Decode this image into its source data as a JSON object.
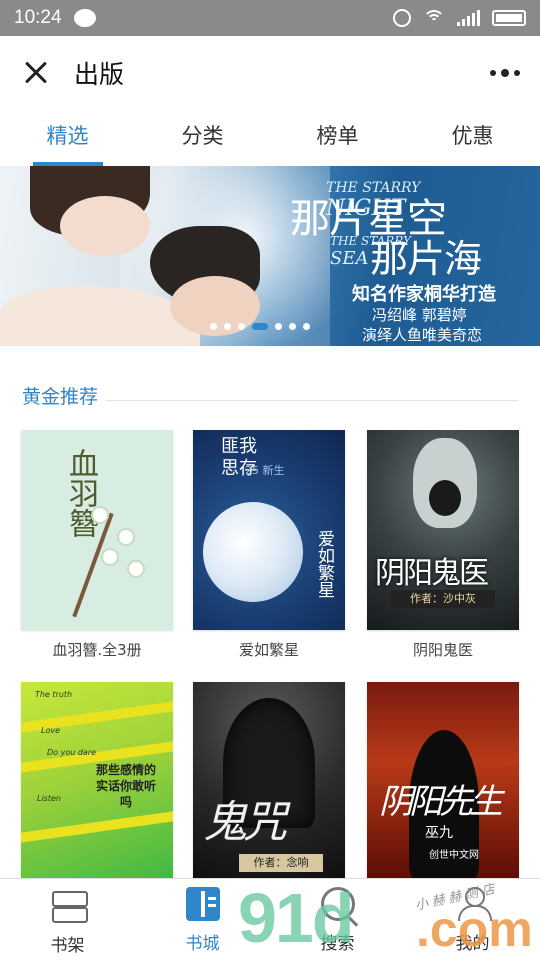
{
  "status_bar": {
    "time": "10:24",
    "icons": [
      "chat-icon",
      "alarm-icon",
      "wifi-icon",
      "signal-icon",
      "battery-icon"
    ]
  },
  "header": {
    "title": "出版",
    "close_icon": "close-icon",
    "more_icon": "more-icon"
  },
  "tabs": [
    {
      "label": "精选",
      "active": true
    },
    {
      "label": "分类",
      "active": false
    },
    {
      "label": "榜单",
      "active": false
    },
    {
      "label": "优惠",
      "active": false
    }
  ],
  "banner": {
    "en_line1_small": "THE STARRY",
    "en_line1_big": "NIGHT",
    "title_line1": "那片星空",
    "en_line2_small": "THE STARRY",
    "en_line2_big": "SEA",
    "title_line2": "那片海",
    "line1": "知名作家桐华打造",
    "line2": "冯绍峰 郭碧婷",
    "line3": "演绎人鱼唯美奇恋",
    "dot_count": 7,
    "active_dot": 3
  },
  "section": {
    "title": "黄金推荐"
  },
  "books": [
    {
      "name": "血羽簪.全3册",
      "cover_title": "血羽簪"
    },
    {
      "name": "爱如繁星",
      "cover_title_top": "匪我思存",
      "cover_title_side": "爱如繁星",
      "cover_note": "25 新生"
    },
    {
      "name": "阴阳鬼医",
      "cover_title": "阴阳鬼医",
      "cover_author": "作者：沙中灰"
    },
    {
      "name": "",
      "cover_text": "那些感情的实话你敢听吗",
      "cover_words": [
        "The truth",
        "Love",
        "Do you dare",
        "Listen"
      ]
    },
    {
      "name": "",
      "cover_title": "鬼咒",
      "cover_author": "作者：念响"
    },
    {
      "name": "",
      "cover_title": "阴阳先生",
      "cover_author": "巫九",
      "cover_brand": "创世中文网"
    }
  ],
  "bottom_nav": [
    {
      "label": "书架",
      "icon": "bookshelf-icon",
      "active": false
    },
    {
      "label": "书城",
      "icon": "bookstore-icon",
      "active": true
    },
    {
      "label": "搜索",
      "icon": "search-icon",
      "active": false
    },
    {
      "label": "我的",
      "icon": "user-icon",
      "active": false
    }
  ],
  "watermark": {
    "text": "91d",
    "suffix": ".com",
    "handwriting": "小赫赫测店"
  },
  "colors": {
    "accent": "#2f86c9",
    "status_bar": "#8a8a8a"
  }
}
